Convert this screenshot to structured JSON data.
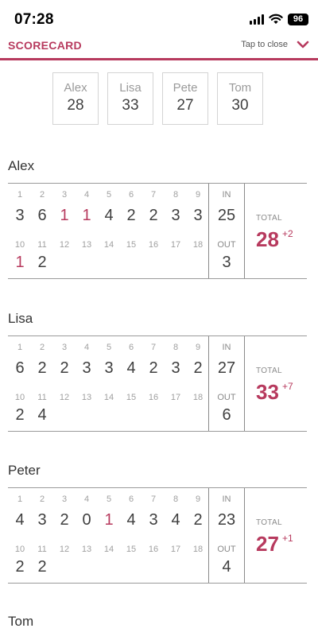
{
  "status_bar": {
    "time": "07:28",
    "battery": "96"
  },
  "header": {
    "title": "SCORECARD",
    "close_label": "Tap to close"
  },
  "summary": [
    {
      "name": "Alex",
      "score": "28"
    },
    {
      "name": "Lisa",
      "score": "33"
    },
    {
      "name": "Pete",
      "score": "27"
    },
    {
      "name": "Tom",
      "score": "30"
    }
  ],
  "labels": {
    "in": "IN",
    "out": "OUT",
    "total": "TOTAL"
  },
  "front_holes": [
    "1",
    "2",
    "3",
    "4",
    "5",
    "6",
    "7",
    "8",
    "9"
  ],
  "back_holes": [
    "10",
    "11",
    "12",
    "13",
    "14",
    "15",
    "16",
    "17",
    "18"
  ],
  "players": [
    {
      "name": "Alex",
      "front": [
        "3",
        "6",
        "1",
        "1",
        "4",
        "2",
        "2",
        "3",
        "3"
      ],
      "back": [
        "1",
        "2",
        "",
        "",
        "",
        "",
        "",
        "",
        ""
      ],
      "in": "25",
      "out": "3",
      "total": "28",
      "diff": "+2"
    },
    {
      "name": "Lisa",
      "front": [
        "6",
        "2",
        "2",
        "3",
        "3",
        "4",
        "2",
        "3",
        "2"
      ],
      "back": [
        "2",
        "4",
        "",
        "",
        "",
        "",
        "",
        "",
        ""
      ],
      "in": "27",
      "out": "6",
      "total": "33",
      "diff": "+7"
    },
    {
      "name": "Peter",
      "front": [
        "4",
        "3",
        "2",
        "0",
        "1",
        "4",
        "3",
        "4",
        "2"
      ],
      "back": [
        "2",
        "2",
        "",
        "",
        "",
        "",
        "",
        "",
        ""
      ],
      "in": "23",
      "out": "4",
      "total": "27",
      "diff": "+1"
    }
  ],
  "next_player": "Tom",
  "colors": {
    "accent": "#b73a5e",
    "text": "#3f3f3f",
    "muted": "#a0a0a0"
  }
}
